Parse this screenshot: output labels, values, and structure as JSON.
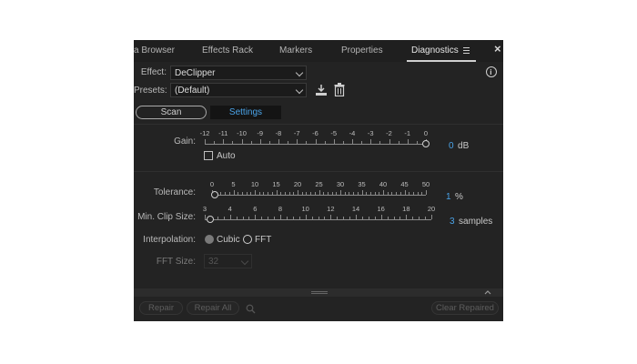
{
  "tabs": [
    {
      "label": "a Browser"
    },
    {
      "label": "Effects Rack"
    },
    {
      "label": "Markers"
    },
    {
      "label": "Properties"
    },
    {
      "label": "Diagnostics",
      "active": true
    }
  ],
  "close_label": "×",
  "effect": {
    "label": "Effect:",
    "value": "DeClipper"
  },
  "presets": {
    "label": "Presets:",
    "value": "(Default)"
  },
  "mode_buttons": {
    "scan": "Scan",
    "settings": "Settings"
  },
  "gain": {
    "label": "Gain:",
    "ticks": [
      "-12",
      "-11",
      "-10",
      "-9",
      "-8",
      "-7",
      "-6",
      "-5",
      "-4",
      "-3",
      "-2",
      "-1",
      "0"
    ],
    "value": "0",
    "unit": "dB",
    "min": -12,
    "max": 0
  },
  "auto": {
    "label": "Auto",
    "checked": false
  },
  "tolerance": {
    "label": "Tolerance:",
    "ticks": [
      "0",
      "5",
      "10",
      "15",
      "20",
      "25",
      "30",
      "35",
      "40",
      "45",
      "50"
    ],
    "value": "1",
    "unit": "%",
    "min": 0,
    "max": 50
  },
  "min_clip_size": {
    "label": "Min. Clip Size:",
    "ticks": [
      "3",
      "4",
      "6",
      "8",
      "10",
      "12",
      "14",
      "16",
      "18",
      "20"
    ],
    "value": "3",
    "unit": "samples",
    "min": 3,
    "max": 20
  },
  "interpolation": {
    "label": "Interpolation:",
    "options": [
      "Cubic",
      "FFT"
    ],
    "selected": "Cubic"
  },
  "fft_size": {
    "label": "FFT Size:",
    "value": "32"
  },
  "footer": {
    "repair": "Repair",
    "repair_all": "Repair All",
    "clear_repaired": "Clear Repaired"
  },
  "colors": {
    "accent": "#4aa3e8",
    "panel": "#232323",
    "tabbar": "#1f1f1f"
  }
}
